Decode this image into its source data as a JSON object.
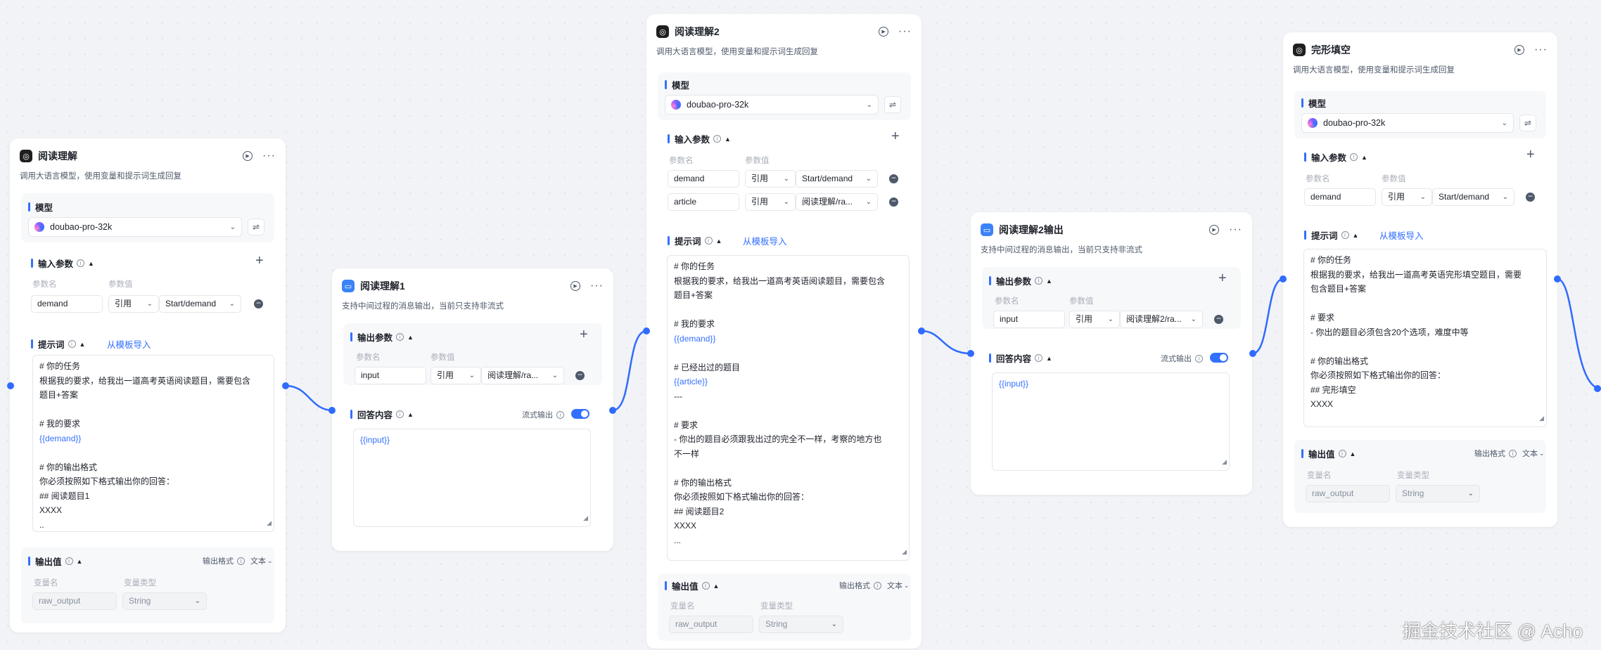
{
  "labels": {
    "param_name": "参数名",
    "param_value": "参数值",
    "var_name": "变量名",
    "var_type": "变量类型",
    "output_format": "输出格式",
    "output_format_value": "文本",
    "import_from_template": "从模板导入",
    "stream_output": "流式输出",
    "model": "模型",
    "input_params": "输入参数",
    "output_params": "输出参数",
    "prompt": "提示词",
    "output_value": "输出值",
    "reply_content": "回答内容",
    "ref": "引用"
  },
  "llm_nodes": [
    {
      "title": "阅读理解",
      "desc": "调用大语言模型，使用变量和提示词生成回复",
      "model": "doubao-pro-32k",
      "params": [
        {
          "name": "demand",
          "ref": "引用",
          "value": "Start/demand"
        }
      ],
      "prompt_lines": [
        "# 你的任务",
        "根据我的要求，给我出一道高考英语阅读题目，需要包含",
        "题目+答案",
        "",
        "# 我的要求",
        "{{demand}}",
        "",
        "# 你的输出格式",
        "你必须按照如下格式输出你的回答：",
        "## 阅读题目1",
        "XXXX",
        ".."
      ],
      "output_name": "raw_output",
      "output_type": "String"
    },
    {
      "title": "阅读理解2",
      "desc": "调用大语言模型，使用变量和提示词生成回复",
      "model": "doubao-pro-32k",
      "params": [
        {
          "name": "demand",
          "ref": "引用",
          "value": "Start/demand"
        },
        {
          "name": "article",
          "ref": "引用",
          "value": "阅读理解/ra..."
        }
      ],
      "prompt_lines": [
        "# 你的任务",
        "根据我的要求，给我出一道高考英语阅读题目，需要包含",
        "题目+答案",
        "",
        "# 我的要求",
        "{{demand}}",
        "",
        "# 已经出过的题目",
        "{{article}}",
        "---",
        "",
        "# 要求",
        "- 你出的题目必须跟我出过的完全不一样，考察的地方也",
        "不一样",
        "",
        "# 你的输出格式",
        "你必须按照如下格式输出你的回答：",
        "## 阅读题目2",
        "XXXX",
        "..."
      ],
      "output_name": "raw_output",
      "output_type": "String"
    },
    {
      "title": "完形填空",
      "desc": "调用大语言模型，使用变量和提示词生成回复",
      "model": "doubao-pro-32k",
      "params": [
        {
          "name": "demand",
          "ref": "引用",
          "value": "Start/demand"
        }
      ],
      "prompt_lines": [
        "# 你的任务",
        "根据我的要求，给我出一道高考英语完形填空题目，需要",
        "包含题目+答案",
        "",
        "# 要求",
        "- 你出的题目必须包含20个选项，难度中等",
        "",
        "# 你的输出格式",
        "你必须按照如下格式输出你的回答：",
        "## 完形填空",
        "XXXX"
      ],
      "output_name": "raw_output",
      "output_type": "String"
    }
  ],
  "msg_nodes": [
    {
      "title": "阅读理解1",
      "desc": "支持中间过程的消息输出，当前只支持非流式",
      "param_name": "input",
      "param_ref": "引用",
      "param_value": "阅读理解/ra...",
      "reply": "{{input}}"
    },
    {
      "title": "阅读理解2输出",
      "desc": "支持中间过程的消息输出，当前只支持非流式",
      "param_name": "input",
      "param_ref": "引用",
      "param_value": "阅读理解2/ra...",
      "reply": "{{input}}"
    }
  ],
  "watermark": "掘金技术社区 @ Acho",
  "colors": {
    "accent": "#3370ff",
    "edge": "#2f6bff",
    "canvas": "#f2f3f6"
  }
}
